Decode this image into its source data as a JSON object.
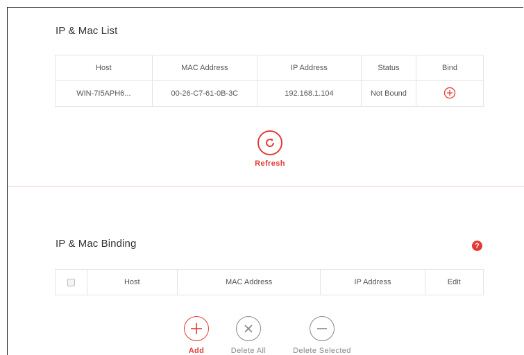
{
  "colors": {
    "accent": "#e53935",
    "muted": "#888888",
    "divider": "#f3c7c7",
    "table_border": "#e4e4e4"
  },
  "ip_mac_list": {
    "title": "IP & Mac List",
    "columns": [
      "Host",
      "MAC Address",
      "IP Address",
      "Status",
      "Bind"
    ],
    "rows": [
      {
        "host": "WIN-7I5APH6...",
        "mac": "00-26-C7-61-0B-3C",
        "ip": "192.168.1.104",
        "status": "Not Bound",
        "bind_icon": "plus-circle-icon"
      }
    ],
    "refresh": {
      "label": "Refresh",
      "icon": "refresh-icon"
    }
  },
  "ip_mac_binding": {
    "title": "IP & Mac Binding",
    "help_icon": "question-icon",
    "columns": [
      "Host",
      "MAC Address",
      "IP Address",
      "Edit"
    ],
    "actions": {
      "add": {
        "label": "Add",
        "icon": "plus-circle-icon"
      },
      "delete_all": {
        "label": "Delete All",
        "icon": "x-circle-icon"
      },
      "delete_selected": {
        "label": "Delete Selected",
        "icon": "minus-circle-icon"
      }
    }
  }
}
